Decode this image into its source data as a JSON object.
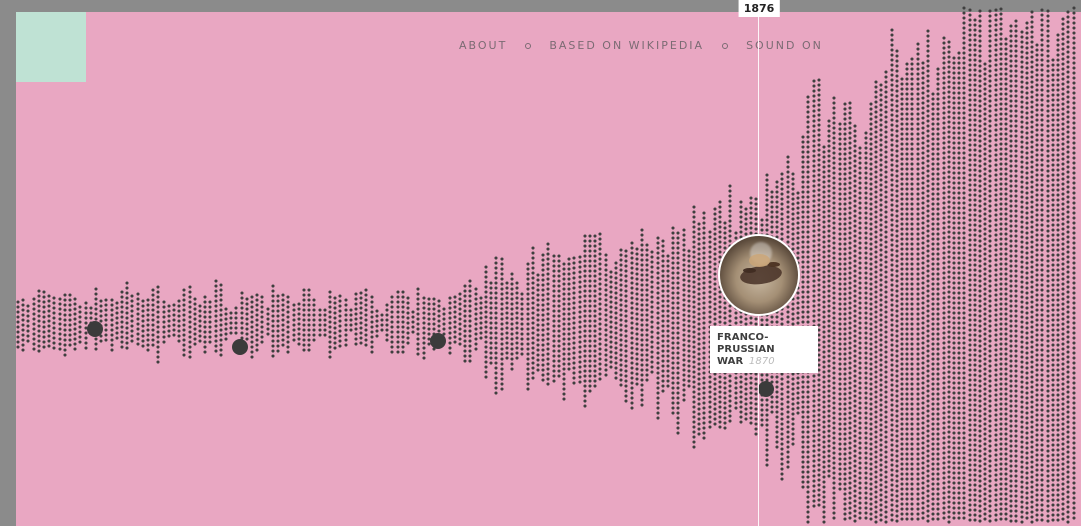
{
  "nav": {
    "items": [
      {
        "label": "ABOUT",
        "name": "nav-about"
      },
      {
        "label": "BASED ON WIKIPEDIA",
        "name": "nav-based-on-wikipedia"
      },
      {
        "label": "SOUND ON",
        "name": "nav-sound-on"
      }
    ]
  },
  "timeline": {
    "current_year": "1876"
  },
  "event": {
    "title_line_1": "FRANCO-PRUSSIAN",
    "title_line_2": "WAR",
    "year": "1870",
    "image_icon": "battle-painting-icon"
  },
  "colors": {
    "background": "#e9a7c2",
    "frame": "#8b8b8b",
    "mint": "#bfe2d4",
    "dot": "#3f3f3f",
    "nav_text": "#7b6b73",
    "accent_line": "#ffffff"
  }
}
